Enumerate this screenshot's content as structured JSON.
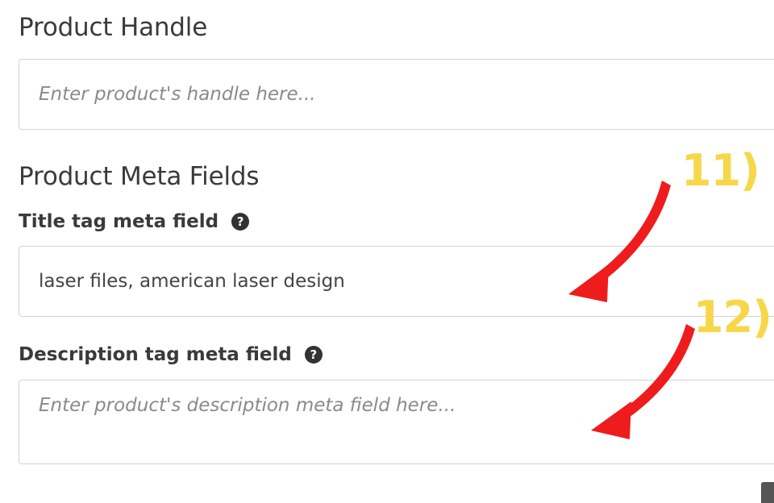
{
  "handle": {
    "title": "Product Handle",
    "placeholder": "Enter product's handle here...",
    "value": ""
  },
  "meta_fields": {
    "title": "Product Meta Fields",
    "title_tag": {
      "label": "Title tag meta field",
      "help_icon": "?",
      "value": "laser files, american laser design",
      "placeholder": ""
    },
    "description_tag": {
      "label": "Description tag meta field",
      "help_icon": "?",
      "value": "",
      "placeholder": "Enter product's description meta field here..."
    }
  },
  "annotations": [
    {
      "label": "11)",
      "color": "#f7d74a",
      "arrow_color": "#ee1c1c"
    },
    {
      "label": "12)",
      "color": "#f7d74a",
      "arrow_color": "#ee1c1c"
    }
  ],
  "icons": {
    "help": "question-circle-icon",
    "arrow": "curved-arrow-icon"
  }
}
